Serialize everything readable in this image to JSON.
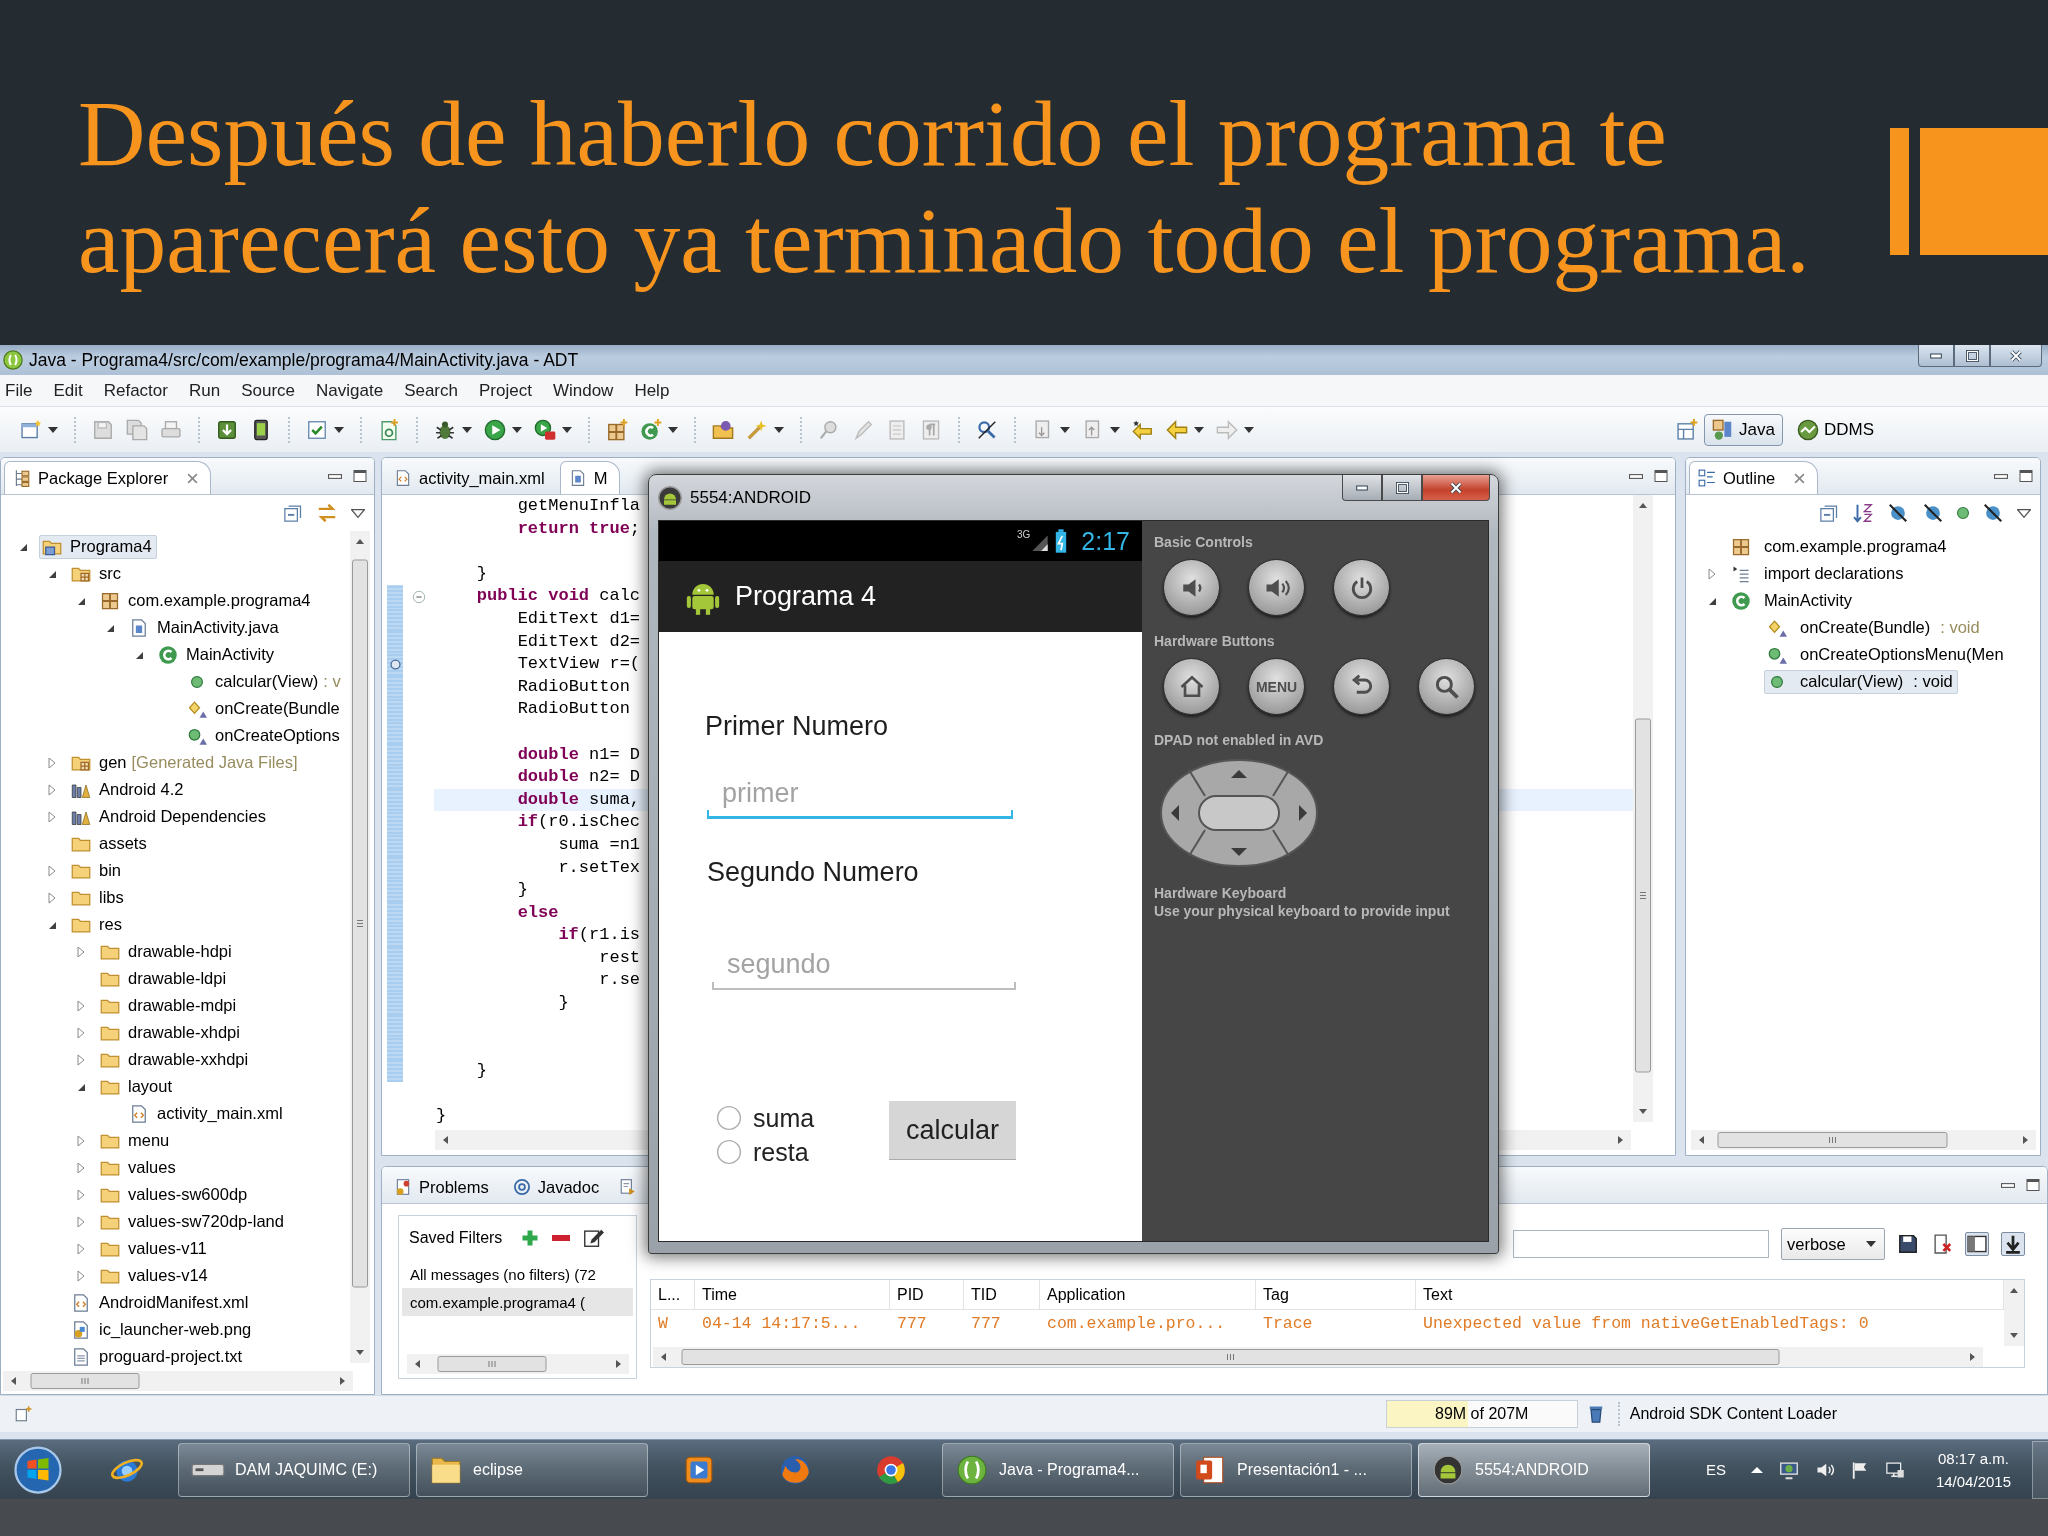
{
  "slide": {
    "title": "Después de haberlo corrido el programa te aparecerá esto ya terminado todo el programa."
  },
  "ide": {
    "title": "Java - Programa4/src/com/example/programa4/MainActivity.java - ADT",
    "menu": [
      "File",
      "Edit",
      "Refactor",
      "Run",
      "Source",
      "Navigate",
      "Search",
      "Project",
      "Window",
      "Help"
    ],
    "perspectives": [
      {
        "label": "Java",
        "kind": "java",
        "selected": true
      },
      {
        "label": "DDMS",
        "kind": "ddms",
        "selected": false
      }
    ],
    "package_explorer": {
      "title": "Package Explorer",
      "tree": [
        {
          "label": "Programa4",
          "kind": "project",
          "expanded": true,
          "selected": true,
          "children": [
            {
              "label": "src",
              "kind": "source-folder",
              "expanded": true,
              "selected": false,
              "children": [
                {
                  "label": "com.example.programa4",
                  "kind": "package",
                  "expanded": true,
                  "selected": false,
                  "children": [
                    {
                      "label": "MainActivity.java",
                      "kind": "java-file",
                      "expanded": true,
                      "selected": false,
                      "children": [
                        {
                          "label": "MainActivity",
                          "kind": "class",
                          "expanded": true,
                          "selected": false,
                          "children": [
                            {
                              "label": "calcular(View)",
                              "suffix": ": v",
                              "kind": "public",
                              "selected": false
                            },
                            {
                              "label": "onCreate(Bundle",
                              "kind": "protected-override",
                              "selected": false
                            },
                            {
                              "label": "onCreateOptions",
                              "kind": "public-override",
                              "selected": false
                            }
                          ]
                        }
                      ]
                    }
                  ]
                }
              ]
            },
            {
              "label": "gen",
              "suffix": "[Generated Java Files]",
              "kind": "source-folder",
              "expanded": false,
              "selected": false
            },
            {
              "label": "Android 4.2",
              "kind": "library",
              "expanded": false,
              "selected": false
            },
            {
              "label": "Android Dependencies",
              "kind": "library",
              "expanded": false,
              "selected": false
            },
            {
              "label": "assets",
              "kind": "folder",
              "selected": false
            },
            {
              "label": "bin",
              "kind": "folder",
              "expanded": false,
              "selected": false
            },
            {
              "label": "libs",
              "kind": "folder",
              "expanded": false,
              "selected": false
            },
            {
              "label": "res",
              "kind": "folder",
              "expanded": true,
              "selected": false,
              "children": [
                {
                  "label": "drawable-hdpi",
                  "kind": "folder",
                  "expanded": false,
                  "selected": false
                },
                {
                  "label": "drawable-ldpi",
                  "kind": "folder",
                  "selected": false
                },
                {
                  "label": "drawable-mdpi",
                  "kind": "folder",
                  "expanded": false,
                  "selected": false
                },
                {
                  "label": "drawable-xhdpi",
                  "kind": "folder",
                  "expanded": false,
                  "selected": false
                },
                {
                  "label": "drawable-xxhdpi",
                  "kind": "folder",
                  "expanded": false,
                  "selected": false
                },
                {
                  "label": "layout",
                  "kind": "folder",
                  "expanded": true,
                  "selected": false,
                  "children": [
                    {
                      "label": "activity_main.xml",
                      "kind": "xml",
                      "selected": false
                    }
                  ]
                },
                {
                  "label": "menu",
                  "kind": "folder",
                  "expanded": false,
                  "selected": false
                },
                {
                  "label": "values",
                  "kind": "folder",
                  "expanded": false,
                  "selected": false
                },
                {
                  "label": "values-sw600dp",
                  "kind": "folder",
                  "expanded": false,
                  "selected": false
                },
                {
                  "label": "values-sw720dp-land",
                  "kind": "folder",
                  "expanded": false,
                  "selected": false
                },
                {
                  "label": "values-v11",
                  "kind": "folder",
                  "expanded": false,
                  "selected": false
                },
                {
                  "label": "values-v14",
                  "kind": "folder",
                  "expanded": false,
                  "selected": false
                }
              ]
            },
            {
              "label": "AndroidManifest.xml",
              "kind": "xml",
              "selected": false
            },
            {
              "label": "ic_launcher-web.png",
              "kind": "image",
              "selected": false
            },
            {
              "label": "proguard-project.txt",
              "kind": "text",
              "selected": false
            }
          ]
        }
      ]
    },
    "editor": {
      "tabs": [
        {
          "label": "activity_main.xml",
          "kind": "xml",
          "selected": false
        },
        {
          "label": "M",
          "kind": "java-file",
          "selected": true
        }
      ],
      "lines": [
        {
          "kind": "code",
          "text": "        getMenuInfla",
          "current": false,
          "marked": false
        },
        {
          "kind": "code",
          "text": "        **return** **true**;",
          "current": false,
          "marked": false
        },
        {
          "kind": "blank",
          "current": false,
          "marked": false
        },
        {
          "kind": "code",
          "text": "    }",
          "current": false,
          "marked": false
        },
        {
          "kind": "fold",
          "text": "    **public** **void** calc",
          "current": false,
          "marked": true
        },
        {
          "kind": "code",
          "text": "        EditText d1=",
          "current": false,
          "marked": true
        },
        {
          "kind": "code",
          "text": "        EditText d2=",
          "current": false,
          "marked": true
        },
        {
          "kind": "occurrence",
          "text": "        TextView r=(",
          "current": false,
          "marked": true
        },
        {
          "kind": "code",
          "text": "        RadioButton",
          "current": false,
          "marked": true
        },
        {
          "kind": "code",
          "text": "        RadioButton",
          "current": false,
          "marked": true
        },
        {
          "kind": "blank",
          "current": false,
          "marked": true
        },
        {
          "kind": "code",
          "text": "        **double** n1= D",
          "current": false,
          "marked": true
        },
        {
          "kind": "code",
          "text": "        **double** n2= D",
          "current": false,
          "marked": true
        },
        {
          "kind": "code",
          "text": "        **double** suma,",
          "current": true,
          "marked": true
        },
        {
          "kind": "code",
          "text": "        **if**(r0.isChec",
          "current": false,
          "marked": true
        },
        {
          "kind": "code",
          "text": "            suma =n1",
          "current": false,
          "marked": true
        },
        {
          "kind": "code",
          "text": "            r.setTex",
          "current": false,
          "marked": true
        },
        {
          "kind": "code",
          "text": "        }",
          "current": false,
          "marked": true
        },
        {
          "kind": "code",
          "text": "        **else**",
          "current": false,
          "marked": true
        },
        {
          "kind": "code",
          "text": "            **if**(r1.is",
          "current": false,
          "marked": true
        },
        {
          "kind": "code",
          "text": "                rest",
          "current": false,
          "marked": true
        },
        {
          "kind": "code",
          "text": "                r.se",
          "current": false,
          "marked": true
        },
        {
          "kind": "code",
          "text": "            }",
          "current": false,
          "marked": true
        },
        {
          "kind": "blank",
          "current": false,
          "marked": true
        },
        {
          "kind": "blank",
          "current": false,
          "marked": true
        },
        {
          "kind": "code",
          "text": "    }",
          "current": false,
          "marked": true
        },
        {
          "kind": "blank",
          "current": false,
          "marked": false
        },
        {
          "kind": "code",
          "text": "}",
          "current": false,
          "marked": false
        }
      ]
    },
    "outline": {
      "title": "Outline",
      "tree": [
        {
          "label": "com.example.programa4",
          "kind": "package",
          "selected": false
        },
        {
          "label": "import declarations",
          "kind": "imports",
          "expanded": false,
          "selected": false
        },
        {
          "label": "MainActivity",
          "kind": "class",
          "expanded": true,
          "selected": false,
          "children": [
            {
              "label": "onCreate(Bundle)",
              "suffix": ": void",
              "kind": "protected-override",
              "selected": false
            },
            {
              "label": "onCreateOptionsMenu(Men",
              "kind": "public-override",
              "selected": false
            },
            {
              "label": "calcular(View)",
              "suffix": ": void",
              "kind": "public",
              "selected": true
            }
          ]
        }
      ]
    },
    "console": {
      "tabs": [
        {
          "label": "Problems",
          "kind": "problems",
          "selected": false
        },
        {
          "label": "Javadoc",
          "kind": "javadoc",
          "selected": false
        },
        {
          "kind": "declaration",
          "selected": false
        }
      ],
      "saved_filters": {
        "title": "Saved Filters",
        "items": [
          {
            "label": "All messages (no filters) (72",
            "selected": false
          },
          {
            "label": "com.example.programa4 (",
            "selected": true
          }
        ]
      },
      "log_level": "verbose",
      "log": {
        "columns": [
          "L...",
          "Time",
          "PID",
          "TID",
          "Application",
          "Tag",
          "Text"
        ],
        "rows": [
          {
            "kind": "warning",
            "cells": [
              "W",
              "04-14 14:17:5...",
              "777",
              "777",
              "com.example.pro...",
              "Trace",
              "Unexpected value from nativeGetEnabledTags: 0"
            ]
          }
        ]
      }
    },
    "status_bar": {
      "heap": {
        "text": "89M of 207M",
        "level": 0.43
      },
      "job": "Android SDK Content Loader"
    }
  },
  "emulator": {
    "title": "5554:ANDROID",
    "phone": {
      "network": "3G",
      "time": "2:17",
      "app_title": "Programa 4",
      "fields": [
        {
          "label": "Primer Numero",
          "placeholder": "primer",
          "focused": true
        },
        {
          "label": "Segundo Numero",
          "placeholder": "segundo",
          "focused": false
        }
      ],
      "options": [
        {
          "label": "suma",
          "selected": false
        },
        {
          "label": "resta",
          "selected": false
        }
      ],
      "button": "calcular"
    },
    "controls": [
      {
        "title": "Basic Controls",
        "kind": "buttons",
        "buttons": [
          {
            "kind": "volume-down"
          },
          {
            "kind": "volume-up"
          },
          {
            "kind": "power"
          }
        ]
      },
      {
        "title": "Hardware Buttons",
        "kind": "buttons",
        "buttons": [
          {
            "kind": "home"
          },
          {
            "kind": "text",
            "label": "MENU"
          },
          {
            "kind": "back"
          },
          {
            "kind": "search"
          }
        ]
      },
      {
        "title": "DPAD not enabled in AVD",
        "kind": "dpad"
      },
      {
        "title": "Hardware Keyboard",
        "kind": "note",
        "text": "Use your physical keyboard to provide input"
      }
    ]
  },
  "taskbar": {
    "items": [
      {
        "kind": "e-globe",
        "selected": false
      },
      {
        "kind": "drive",
        "label": "DAM JAQUIMC (E:)",
        "selected": false
      },
      {
        "kind": "folder",
        "label": "eclipse",
        "selected": false
      },
      {
        "kind": "play",
        "selected": false
      },
      {
        "kind": "fox",
        "selected": false
      },
      {
        "kind": "wheel",
        "selected": false
      },
      {
        "kind": "braces",
        "label": "Java - Programa4...",
        "selected": false
      },
      {
        "kind": "slides",
        "label": "Presentación1 - ...",
        "selected": false
      },
      {
        "kind": "robot",
        "label": "5554:ANDROID",
        "selected": true
      }
    ],
    "tray": {
      "language": "ES",
      "time": "08:17 a.m.",
      "date": "14/04/2015"
    }
  }
}
